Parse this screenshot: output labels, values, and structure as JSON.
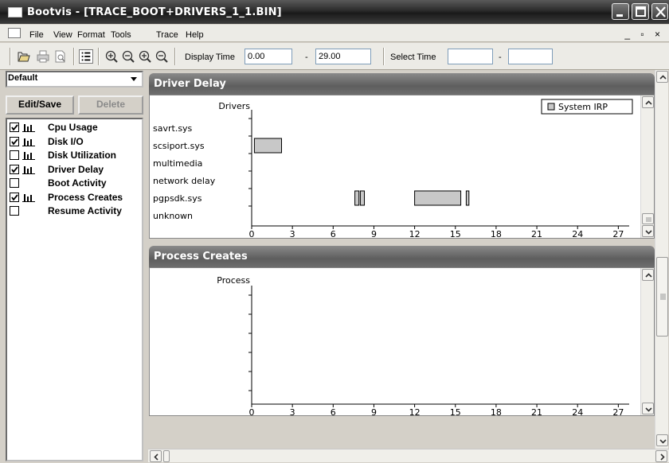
{
  "window": {
    "title": "Bootvis - [TRACE_BOOT+DRIVERS_1_1.BIN]"
  },
  "menu": [
    "File",
    "View",
    "Format",
    "Tools",
    "Trace",
    "Help"
  ],
  "mdi_controls": "_ ▫ ×",
  "toolbar": {
    "display_time_label": "Display Time",
    "display_time_start": "0.00",
    "display_time_dash": "-",
    "display_time_end": "29.00",
    "select_time_label": "Select Time",
    "select_time_start": "",
    "select_time_dash": "-",
    "select_time_end": ""
  },
  "sidebar": {
    "profile": "Default",
    "edit_save_label": "Edit/Save",
    "delete_label": "Delete",
    "items": [
      {
        "label": "Cpu Usage",
        "checked": true,
        "has_chart_icon": true
      },
      {
        "label": "Disk I/O",
        "checked": true,
        "has_chart_icon": true
      },
      {
        "label": "Disk Utilization",
        "checked": false,
        "has_chart_icon": true
      },
      {
        "label": "Driver Delay",
        "checked": true,
        "has_chart_icon": true
      },
      {
        "label": "Boot Activity",
        "checked": false,
        "has_chart_icon": false
      },
      {
        "label": "Process Creates",
        "checked": true,
        "has_chart_icon": true
      },
      {
        "label": "Resume Activity",
        "checked": false,
        "has_chart_icon": false
      }
    ]
  },
  "chart_data": [
    {
      "type": "gantt",
      "title": "Driver Delay",
      "ylabel": "Drivers",
      "categories": [
        "savrt.sys",
        "scsiport.sys",
        "multimedia",
        "network delay",
        "pgpsdk.sys",
        "unknown"
      ],
      "x_ticks": [
        0,
        3,
        6,
        9,
        12,
        15,
        18,
        21,
        24,
        27
      ],
      "xlim": [
        0,
        27.8
      ],
      "legend": {
        "label": "System IRP",
        "position": "top-right"
      },
      "series": [
        {
          "name": "System IRP",
          "color": "#c8c8c8",
          "bars": [
            {
              "category": "scsiport.sys",
              "start": 0.2,
              "end": 2.2
            },
            {
              "category": "pgpsdk.sys",
              "start": 7.6,
              "end": 7.9
            },
            {
              "category": "pgpsdk.sys",
              "start": 8.0,
              "end": 8.3
            },
            {
              "category": "pgpsdk.sys",
              "start": 12.0,
              "end": 15.4
            },
            {
              "category": "pgpsdk.sys",
              "start": 15.8,
              "end": 16.0
            }
          ]
        }
      ]
    },
    {
      "type": "gantt",
      "title": "Process Creates",
      "ylabel": "Process",
      "categories": [],
      "x_ticks": [
        0,
        3,
        6,
        9,
        12,
        15,
        18,
        21,
        24,
        27
      ],
      "xlim": [
        0,
        27.8
      ],
      "series": []
    }
  ]
}
